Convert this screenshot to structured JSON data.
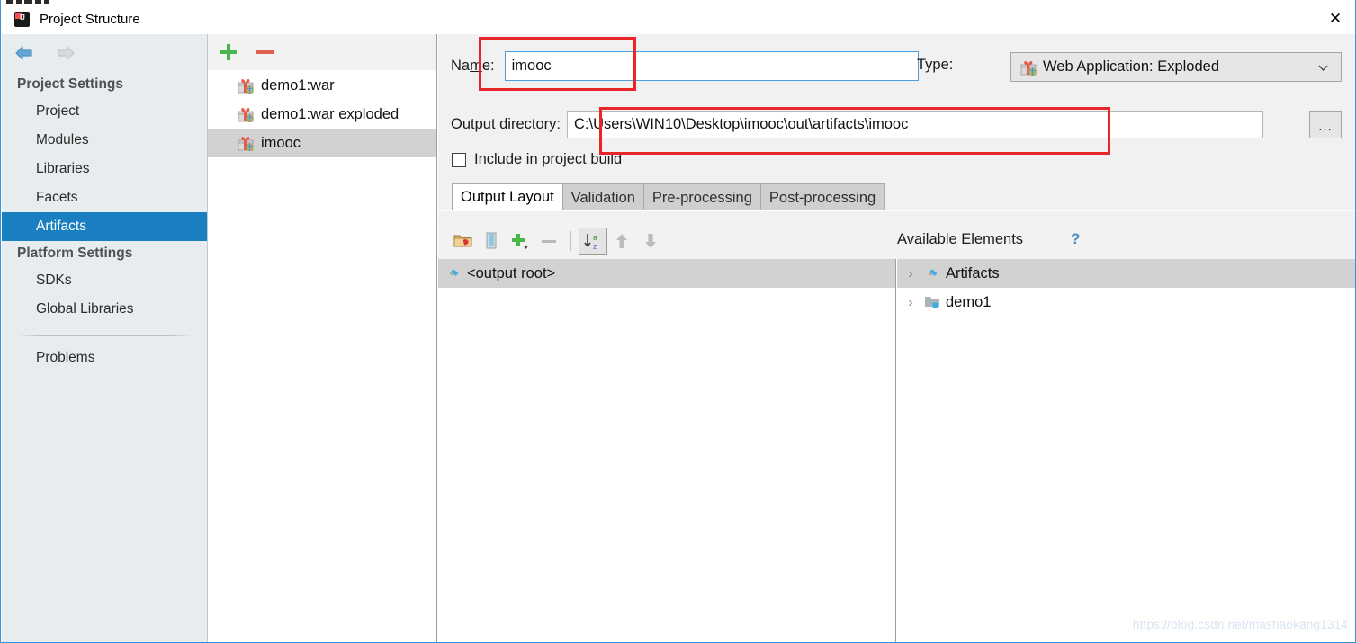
{
  "window": {
    "title": "Project Structure",
    "logo_icon": "intellij-idea-logo-icon",
    "close_icon": "close-icon"
  },
  "sidebar": {
    "back_icon": "back-arrow-icon",
    "forward_icon": "forward-arrow-icon",
    "groups": [
      {
        "title": "Project Settings",
        "items": [
          {
            "label": "Project",
            "selected": false
          },
          {
            "label": "Modules",
            "selected": false
          },
          {
            "label": "Libraries",
            "selected": false
          },
          {
            "label": "Facets",
            "selected": false
          },
          {
            "label": "Artifacts",
            "selected": true
          }
        ]
      },
      {
        "title": "Platform Settings",
        "items": [
          {
            "label": "SDKs",
            "selected": false
          },
          {
            "label": "Global Libraries",
            "selected": false
          }
        ]
      }
    ],
    "problems_label": "Problems"
  },
  "artifact_list": {
    "toolbar": {
      "add_label": "+",
      "add_icon": "plus-icon",
      "remove_icon": "minus-icon"
    },
    "items": [
      {
        "label": "demo1:war",
        "icon": "artifact-gift-icon",
        "selected": false
      },
      {
        "label": "demo1:war exploded",
        "icon": "artifact-gift-icon",
        "selected": false
      },
      {
        "label": "imooc",
        "icon": "artifact-gift-icon",
        "selected": true
      }
    ]
  },
  "detail": {
    "name": {
      "label_prefix": "Na",
      "label_mnemonic": "m",
      "label_suffix": "e:",
      "value": "imooc"
    },
    "type": {
      "label": "Type:",
      "value": "Web Application: Exploded",
      "icon": "artifact-gift-icon",
      "caret_icon": "chevron-down-icon"
    },
    "output_directory": {
      "label": "Output directory:",
      "value": "C:\\Users\\WIN10\\Desktop\\imooc\\out\\artifacts\\imooc",
      "browse_label": "..."
    },
    "include_in_build": {
      "label_prefix": "Include in project ",
      "label_mnemonic": "b",
      "label_suffix": "uild",
      "checked": false
    },
    "tabs": [
      {
        "label": "Output Layout",
        "active": true
      },
      {
        "label": "Validation",
        "active": false
      },
      {
        "label": "Pre-processing",
        "active": false
      },
      {
        "label": "Post-processing",
        "active": false
      }
    ],
    "layout_toolbar": [
      {
        "icon": "create-directory-icon",
        "enabled": true,
        "toggled": false
      },
      {
        "icon": "create-archive-icon",
        "enabled": true,
        "toggled": false
      },
      {
        "icon": "add-copy-of-icon",
        "enabled": true,
        "toggled": false
      },
      {
        "icon": "remove-icon",
        "enabled": false,
        "toggled": false
      },
      {
        "icon": "sort-alphabetically-icon",
        "enabled": true,
        "toggled": true
      },
      {
        "icon": "move-up-icon",
        "enabled": false,
        "toggled": false
      },
      {
        "icon": "move-down-icon",
        "enabled": false,
        "toggled": false
      }
    ],
    "available_elements": {
      "header": "Available Elements",
      "help_icon": "help-question-icon",
      "help_label": "?"
    },
    "output_tree": [
      {
        "label": "<output root>",
        "icon": "output-root-diamond-icon",
        "selected": true,
        "twisty": false
      }
    ],
    "available_tree": [
      {
        "label": "Artifacts",
        "icon": "artifacts-diamond-icon",
        "selected": true,
        "twisty": true
      },
      {
        "label": "demo1",
        "icon": "module-folder-icon",
        "selected": false,
        "twisty": true
      }
    ]
  },
  "annotations": {
    "name_box_color": "#e8262a",
    "output_box_color": "#e8262a"
  },
  "watermark": "https://blog.csdn.net/mashaokang1314"
}
